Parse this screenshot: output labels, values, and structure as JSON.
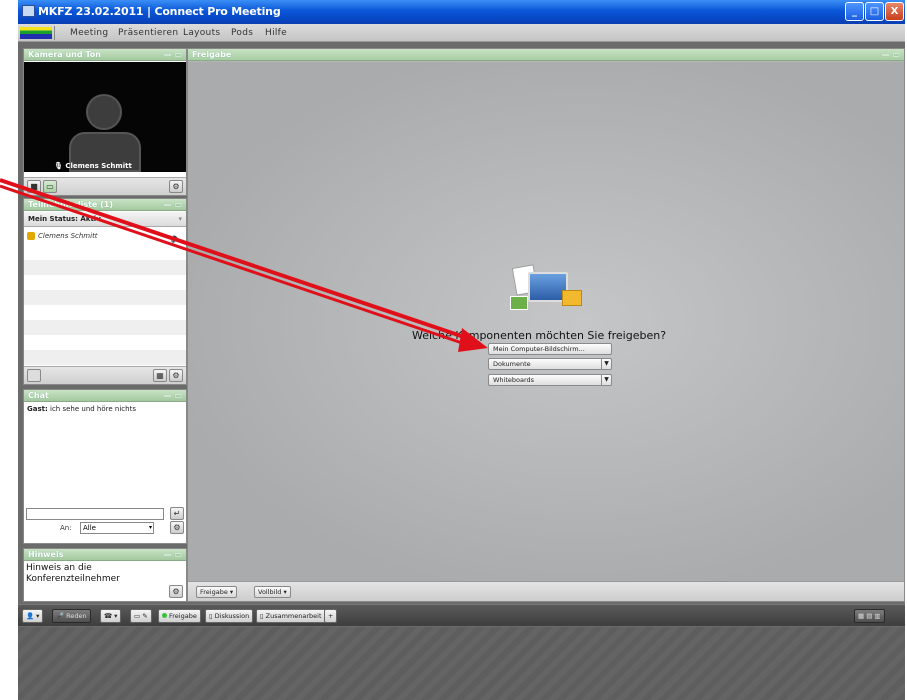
{
  "window": {
    "title": "MKFZ 23.02.2011 | Connect Pro Meeting",
    "controls": {
      "minimize": "_",
      "maximize": "□",
      "close": "X"
    }
  },
  "menu": [
    "Meeting",
    "Präsentieren",
    "Layouts",
    "Pods",
    "Hilfe"
  ],
  "camera_pod": {
    "title": "Kamera und Ton",
    "participant_name": "Clemens Schmitt"
  },
  "attendee_pod": {
    "title": "Teilnehmerliste (1)",
    "status_text": "Mein Status: Aktiv",
    "attendees": [
      {
        "name": "Clemens Schmitt"
      }
    ]
  },
  "chat_pod": {
    "title": "Chat",
    "messages": [
      {
        "sender": "Gast:",
        "text": "ich sehe und höre nichts"
      }
    ],
    "recipient_label": "An:",
    "recipient_value": "Alle"
  },
  "notes_pod": {
    "title": "Hinweis",
    "text": "Hinweis an die Konferenzteilnehmer"
  },
  "share_pod": {
    "title": "Freigabe",
    "question": "Welche Komponenten möchten Sie freigeben?",
    "options": [
      "Mein Computer-Bildschirm...",
      "Dokumente",
      "Whiteboards"
    ],
    "footer": {
      "share_button": "Freigabe",
      "fullscreen_button": "Vollbild"
    }
  },
  "toolbar": {
    "talk_button": "Reden",
    "layouts": [
      "Freigabe",
      "Diskussion",
      "Zusammenarbeit"
    ],
    "add_layout": "+"
  },
  "colors": {
    "titlebar": "#0a56d8",
    "pod_header": "#a3c99e",
    "annotation_arrow": "#e0101a"
  }
}
